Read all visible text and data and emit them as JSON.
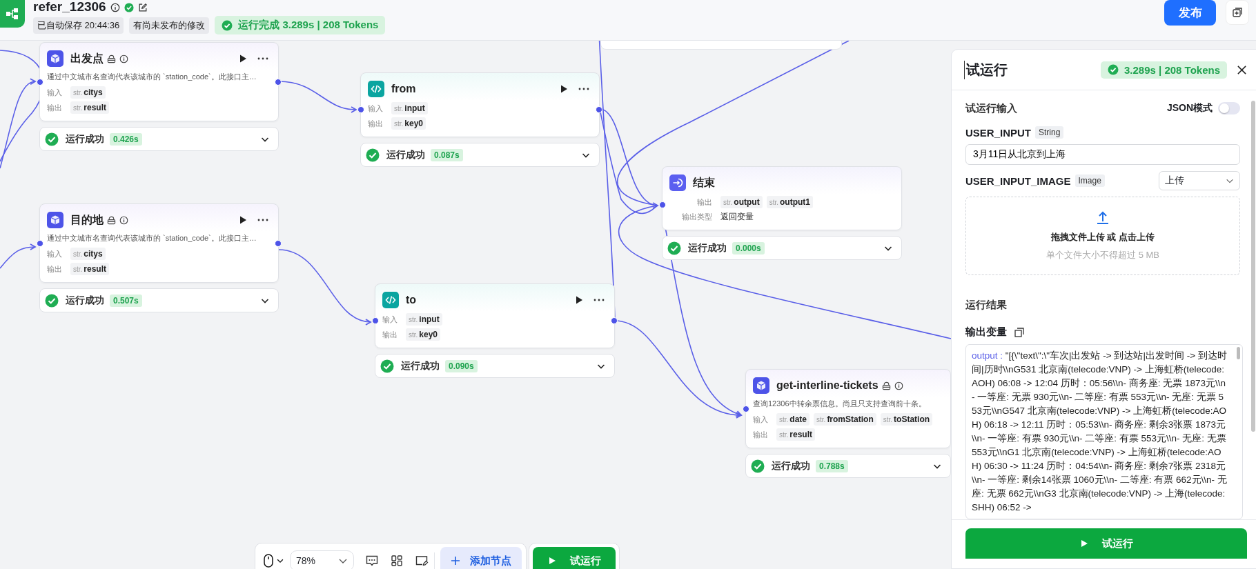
{
  "header": {
    "title": "refer_12306",
    "autosave": "已自动保存 20:44:36",
    "unpublished": "有尚未发布的修改",
    "run_status": "运行完成 3.289s | 208 Tokens",
    "publish_button": "发布"
  },
  "canvas": {
    "nodes": [
      {
        "kind": "plugin",
        "title": "出发点",
        "actions": true,
        "description": "通过中文城市名查询代表该城市的 `station_code`。此接口主…",
        "rows": [
          {
            "label": "输入",
            "params": [
              {
                "type": "str.",
                "name": "citys"
              }
            ]
          },
          {
            "label": "输出",
            "params": [
              {
                "type": "str.",
                "name": "result"
              }
            ]
          }
        ],
        "status": {
          "text": "运行成功",
          "time": "0.426s"
        }
      },
      {
        "kind": "code",
        "title": "from",
        "actions": true,
        "rows": [
          {
            "label": "输入",
            "params": [
              {
                "type": "str.",
                "name": "input"
              }
            ]
          },
          {
            "label": "输出",
            "params": [
              {
                "type": "str.",
                "name": "key0"
              }
            ]
          }
        ],
        "status": {
          "text": "运行成功",
          "time": "0.087s"
        }
      },
      {
        "kind": "plugin",
        "title": "目的地",
        "actions": true,
        "description": "通过中文城市名查询代表该城市的 `station_code`。此接口主…",
        "rows": [
          {
            "label": "输入",
            "params": [
              {
                "type": "str.",
                "name": "citys"
              }
            ]
          },
          {
            "label": "输出",
            "params": [
              {
                "type": "str.",
                "name": "result"
              }
            ]
          }
        ],
        "status": {
          "text": "运行成功",
          "time": "0.507s"
        }
      },
      {
        "kind": "code",
        "title": "to",
        "actions": true,
        "rows": [
          {
            "label": "输入",
            "params": [
              {
                "type": "str.",
                "name": "input"
              }
            ]
          },
          {
            "label": "输出",
            "params": [
              {
                "type": "str.",
                "name": "key0"
              }
            ]
          }
        ],
        "status": {
          "text": "运行成功",
          "time": "0.090s"
        }
      },
      {
        "kind": "end",
        "title": "结束",
        "actions": false,
        "rows": [
          {
            "label": "输出",
            "params": [
              {
                "type": "str.",
                "name": "output"
              },
              {
                "type": "str.",
                "name": "output1"
              }
            ]
          },
          {
            "label": "输出类型",
            "value": "返回变量"
          }
        ],
        "status": {
          "text": "运行成功",
          "time": "0.000s"
        }
      },
      {
        "kind": "plugin",
        "title": "get-interline-tickets",
        "actions": false,
        "description": "查询12306中转余票信息。尚且只支持查询前十条。",
        "rows": [
          {
            "label": "输入",
            "params": [
              {
                "type": "str.",
                "name": "date"
              },
              {
                "type": "str.",
                "name": "fromStation"
              },
              {
                "type": "str.",
                "name": "toStation"
              }
            ]
          },
          {
            "label": "输出",
            "params": [
              {
                "type": "str.",
                "name": "result"
              }
            ]
          }
        ],
        "status": {
          "text": "运行成功",
          "time": "0.788s"
        }
      }
    ]
  },
  "toolbar": {
    "zoom": "78%",
    "add_node": "添加节点",
    "run_button": "试运行"
  },
  "test_run_panel": {
    "title": "试运行",
    "badge": "3.289s | 208 Tokens",
    "input_section": "试运行输入",
    "json_mode": {
      "label": "JSON模式",
      "on": false
    },
    "fields": [
      {
        "kind": "text",
        "name": "USER_INPUT",
        "type": "String",
        "value": "3月11日从北京到上海"
      },
      {
        "kind": "upload",
        "name": "USER_INPUT_IMAGE",
        "type": "Image",
        "select": "上传",
        "drop_title": "拖拽文件上传 或 点击上传",
        "drop_hint": "单个文件大小不得超过 5 MB"
      }
    ],
    "result_section": "运行结果",
    "output_label": "输出变量",
    "output": {
      "key": "output :",
      "value": "\"[{\\\"text\\\":\\\"车次|出发站 -> 到达站|出发时间 -> 到达时间|历时\\\\nG531 北京南(telecode:VNP) -> 上海虹桥(telecode:AOH) 06:08 -> 12:04 历时：05:56\\\\n- 商务座: 无票 1873元\\\\n- 一等座: 无票 930元\\\\n- 二等座: 有票 553元\\\\n- 无座: 无票 553元\\\\nG547 北京南(telecode:VNP) -> 上海虹桥(telecode:AOH) 06:18 -> 12:11 历时：05:53\\\\n- 商务座: 剩余3张票 1873元\\\\n- 一等座: 有票 930元\\\\n- 二等座: 有票 553元\\\\n- 无座: 无票 553元\\\\nG1 北京南(telecode:VNP) -> 上海虹桥(telecode:AOH) 06:30 -> 11:24 历时：04:54\\\\n- 商务座: 剩余7张票 2318元\\\\n- 一等座: 剩余14张票 1060元\\\\n- 二等座: 有票 662元\\\\n- 无座: 无票 662元\\\\nG3 北京南(telecode:VNP) -> 上海(telecode:SHH) 06:52 ->"
    },
    "run_button": "试运行"
  }
}
